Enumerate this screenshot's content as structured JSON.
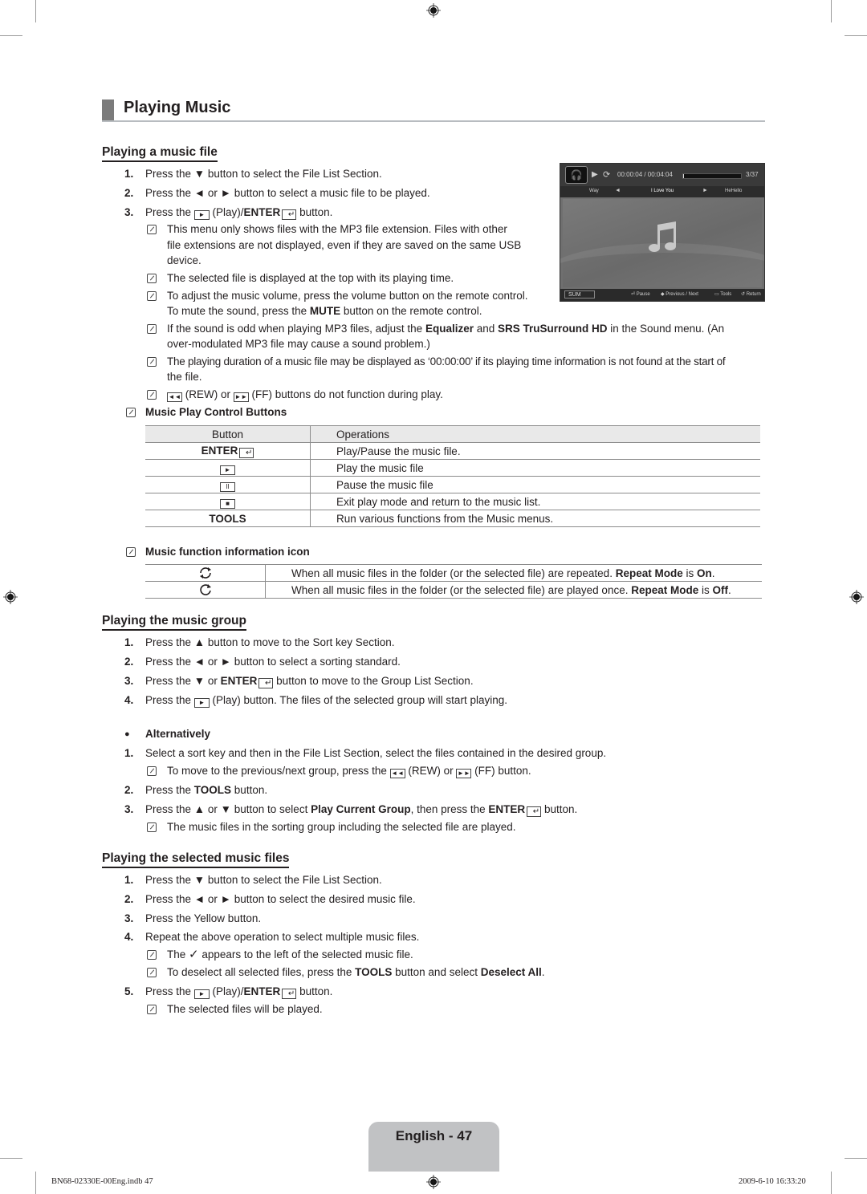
{
  "page_title": "Playing Music",
  "sections": {
    "music_file": {
      "heading": "Playing a music file",
      "steps": [
        {
          "n": "1.",
          "pre": "Press the ",
          "sym": "▼",
          "post": " button to select the File List Section."
        },
        {
          "n": "2.",
          "pre": "Press the ",
          "sym": "◄ or ►",
          "post": " button to select a music file to be played."
        },
        {
          "n": "3.",
          "pre": "Press the ",
          "mid": " (Play)/",
          "bold": "ENTER",
          "post": " button."
        }
      ],
      "notes": [
        {
          "l1": "This menu only shows files with the MP3 file extension. Files with other",
          "l2": "file extensions are not displayed, even if they are saved on the same USB",
          "l3": "device."
        },
        {
          "l1": "The selected file is displayed at the top with its playing time."
        },
        {
          "l1": "To adjust the music volume, press the volume button on the remote control.",
          "l2_pre": "To mute the sound, press the ",
          "l2_bold": "MUTE",
          "l2_post": " button on the remote control."
        },
        {
          "l1_pre": "If the sound is odd when playing MP3 files, adjust the ",
          "b1": "Equalizer",
          "mid": " and ",
          "b2": "SRS TruSurround HD",
          "l1_post": " in the Sound menu. (An",
          "l2": "over-modulated MP3 file may cause a sound problem.)"
        },
        {
          "l1": "The playing duration of a music file may be displayed as ‘00:00:00’ if its playing time information is not found at the start of",
          "l2": "the file."
        },
        {
          "rew": "(REW) or",
          "ff": "(FF) buttons do not function during play."
        }
      ],
      "control_title": "Music Play Control Buttons",
      "control_table": {
        "headers": [
          "Button",
          "Operations"
        ],
        "rows": [
          {
            "button": "ENTER",
            "button_icon": "enter-icon",
            "op": "Play/Pause the music file."
          },
          {
            "button": "►",
            "button_icon": "play-icon",
            "op": "Play the music file"
          },
          {
            "button": "II",
            "button_icon": "pause-icon",
            "op": "Pause the music file"
          },
          {
            "button": "■",
            "button_icon": "stop-icon",
            "op": "Exit play mode and return to the music list."
          },
          {
            "button": "TOOLS",
            "button_icon": "",
            "op": "Run various functions from the Music menus."
          }
        ]
      },
      "icon_title": "Music function information icon",
      "icon_table": [
        {
          "icon": "repeat-on-icon",
          "pre": "When all music files in the folder (or the selected file) are repeated. ",
          "b1": "Repeat Mode",
          "mid": " is ",
          "b2": "On",
          "post": "."
        },
        {
          "icon": "repeat-off-icon",
          "pre": "When all music files in the folder (or the selected file) are played once. ",
          "b1": "Repeat Mode",
          "mid": " is ",
          "b2": "Off",
          "post": "."
        }
      ]
    },
    "music_group": {
      "heading": "Playing the music group",
      "steps": [
        {
          "n": "1.",
          "text": "Press the ▲ button to move to the Sort key Section."
        },
        {
          "n": "2.",
          "text": "Press the ◄ or ► button to select a sorting standard."
        },
        {
          "n": "3.",
          "pre": "Press the ▼ or ",
          "bold": "ENTER",
          "post": " button to move to the Group List Section."
        },
        {
          "n": "4.",
          "pre": "Press the ",
          "post": " (Play) button. The files of the selected group will start playing."
        }
      ],
      "alt_heading": "Alternatively",
      "alt_steps": [
        {
          "n": "1.",
          "text": "Select a sort key and then in the File List Section, select the files contained in the desired group."
        },
        {
          "note_pre": "To move to the previous/next group, press the ",
          "rew": " (REW) or ",
          "ff": " (FF) button."
        },
        {
          "n": "2.",
          "pre": "Press the ",
          "bold": "TOOLS",
          "post": " button."
        },
        {
          "n": "3.",
          "pre": "Press the ▲ or ▼ button to select ",
          "bold": "Play Current Group",
          "mid": ", then press the ",
          "bold2": "ENTER",
          "post": " button."
        },
        {
          "note": "The music files in the sorting group including the selected file are played."
        }
      ]
    },
    "selected_files": {
      "heading": "Playing the selected music files",
      "steps": [
        {
          "n": "1.",
          "text": "Press the ▼ button to select the File List Section."
        },
        {
          "n": "2.",
          "text": "Press the ◄ or ► button to select the desired music file."
        },
        {
          "n": "3.",
          "text": "Press the Yellow button."
        },
        {
          "n": "4.",
          "text": "Repeat the above operation to select multiple music files."
        },
        {
          "note_pre": "The ",
          "check": "✓",
          "note_post": " appears to the left of the selected music file."
        },
        {
          "note_pre": "To deselect all selected files, press the ",
          "b1": "TOOLS",
          "mid": " button and select ",
          "b2": "Deselect All",
          "post": "."
        },
        {
          "n": "5.",
          "pre": "Press the ",
          "mid": " (Play)/",
          "bold": "ENTER",
          "post": " button."
        },
        {
          "note": "The selected files will be played."
        }
      ]
    }
  },
  "tv_screen": {
    "elapsed": "00:00:04",
    "total": "00:04:04",
    "time_display": "00:00:04 / 00:04:04",
    "progress_fraction": 0.02,
    "track_index": "3/37",
    "prev_track": "Way",
    "current_track": "I Love You",
    "next_track": "HeHello",
    "sound_mode": "SUM",
    "hints": [
      "Pause",
      "Previous / Next",
      "Tools",
      "Return"
    ]
  },
  "footer": {
    "page_label": "English - 47",
    "file_slug": "BN68-02330E-00Eng.indb   47",
    "timestamp": "2009-6-10   16:33:20"
  }
}
